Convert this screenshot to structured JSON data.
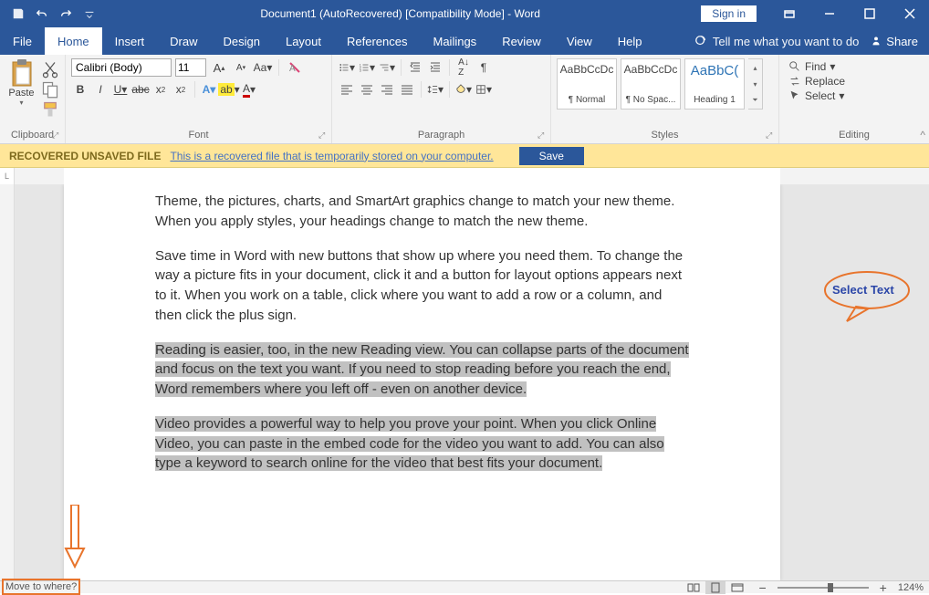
{
  "titlebar": {
    "title": "Document1 (AutoRecovered) [Compatibility Mode]  -  Word",
    "signin": "Sign in"
  },
  "tabs": {
    "file": "File",
    "home": "Home",
    "insert": "Insert",
    "draw": "Draw",
    "design": "Design",
    "layout": "Layout",
    "references": "References",
    "mailings": "Mailings",
    "review": "Review",
    "view": "View",
    "help": "Help",
    "tell_me": "Tell me what you want to do",
    "share": "Share"
  },
  "ribbon": {
    "clipboard": {
      "label": "Clipboard",
      "paste": "Paste"
    },
    "font": {
      "label": "Font",
      "name": "Calibri (Body)",
      "size": "11"
    },
    "paragraph": {
      "label": "Paragraph"
    },
    "styles": {
      "label": "Styles",
      "items": [
        {
          "preview": "AaBbCcDc",
          "name": "¶ Normal"
        },
        {
          "preview": "AaBbCcDc",
          "name": "¶ No Spac..."
        },
        {
          "preview": "AaBbC(",
          "name": "Heading 1"
        }
      ]
    },
    "editing": {
      "label": "Editing",
      "find": "Find",
      "replace": "Replace",
      "select": "Select"
    }
  },
  "recovery": {
    "header": "RECOVERED UNSAVED FILE",
    "message": "This is a recovered file that is temporarily stored on your computer.",
    "save": "Save"
  },
  "document": {
    "p1": "Theme, the pictures, charts, and SmartArt graphics change to match your new theme. When you apply styles, your headings change to match the new theme.",
    "p2": "Save time in Word with new buttons that show up where you need them. To change the way a picture fits in your document, click it and a button for layout options appears next to it. When you work on a table, click where you want to add a row or a column, and then click the plus sign.",
    "p3a": "Reading is easier, too, in the new Reading view. You can collapse parts of the document and focus on the text you want. If you need to stop reading before you reach the end, Word remembers where you left off - even on another device.",
    "p4a": "Video provides a powerful way to help you prove your point. When you click Online Video, you can paste in the embed code for the video you want to add. You can also type a keyword to search online for the video that best fits your document."
  },
  "annotations": {
    "select_text": "Select Text"
  },
  "statusbar": {
    "move_to": "Move to where?",
    "zoom": "124%"
  }
}
